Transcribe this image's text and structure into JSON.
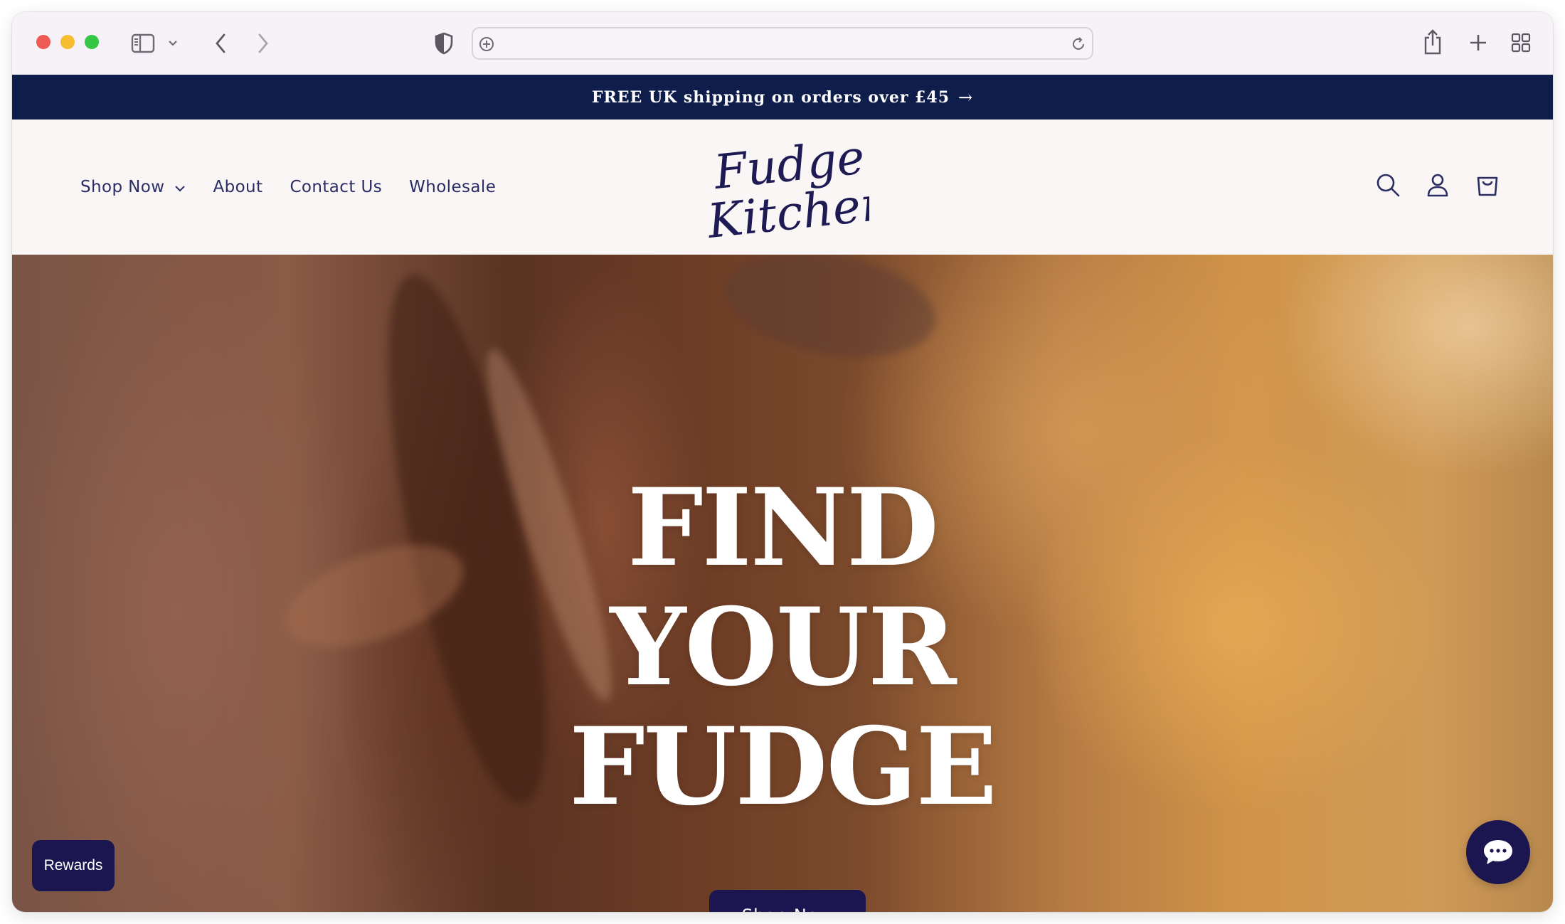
{
  "browser": {
    "url": "",
    "icons": [
      "sidebar-icon",
      "chevron-down-icon",
      "back-icon",
      "forward-icon",
      "privacy-shield-icon",
      "site-settings-icon",
      "reload-icon",
      "share-icon",
      "new-tab-icon",
      "tab-overview-icon"
    ]
  },
  "announcement": {
    "text": "FREE UK shipping on orders over £45",
    "arrow": "→"
  },
  "nav": {
    "items": [
      {
        "label": "Shop Now",
        "has_dropdown": true
      },
      {
        "label": "About"
      },
      {
        "label": "Contact Us"
      },
      {
        "label": "Wholesale"
      }
    ]
  },
  "logo": {
    "line1": "Fudge",
    "line2": "Kitchen"
  },
  "header_icons": [
    "search-icon",
    "account-icon",
    "cart-icon"
  ],
  "hero": {
    "title_lines": [
      "FIND",
      "YOUR",
      "FUDGE"
    ],
    "button_label": "Shop Now"
  },
  "widgets": {
    "rewards_label": "Rewards",
    "chat_icon": "chat-bubble-icon"
  },
  "colors": {
    "brand_navy": "#0f1d4b",
    "nav_text": "#2a2d63",
    "button_bg": "#1b1650",
    "header_bg": "#faf6f5"
  }
}
